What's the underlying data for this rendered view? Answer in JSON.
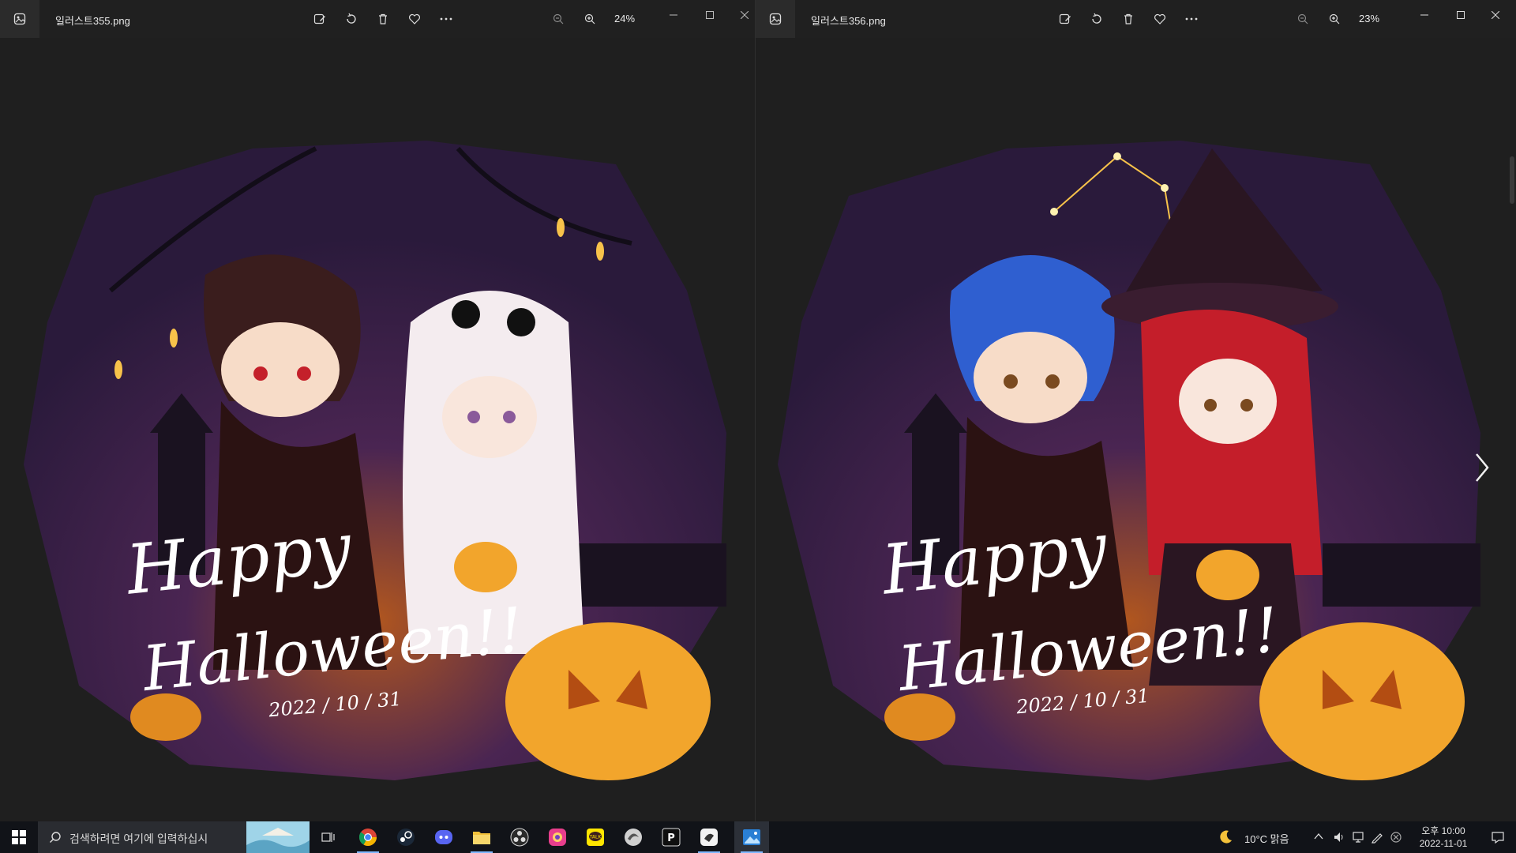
{
  "viewers": [
    {
      "filename": "일러스트355.png",
      "zoom": "24%",
      "artwork": {
        "line1": "Happy",
        "line2": "Halloween!!",
        "date": "2022 / 10 / 31"
      }
    },
    {
      "filename": "일러스트356.png",
      "zoom": "23%",
      "artwork": {
        "line1": "Happy",
        "line2": "Halloween!!",
        "date": "2022 / 10 / 31"
      }
    }
  ],
  "toolbar_icons": [
    "edit-image-icon",
    "rotate-icon",
    "delete-icon",
    "favorite-icon",
    "more-icon",
    "zoom-out-icon",
    "zoom-in-icon"
  ],
  "taskbar": {
    "search_placeholder": "검색하려면 여기에 입력하십시",
    "apps": [
      "task-view",
      "chrome",
      "steam",
      "discord",
      "file-explorer",
      "obs",
      "photo-app",
      "kakaotalk",
      "edge-like",
      "pixiv",
      "clip-studio",
      "photos"
    ],
    "weather": "10°C  맑음",
    "clock_time": "오후 10:00",
    "clock_date": "2022-11-01"
  },
  "colors": {
    "titlebar": "#202020",
    "viewer_bg": "#1f1f1f",
    "taskbar": "#111318",
    "art_purple": "#3d2457",
    "pumpkin": "#f2a52c"
  }
}
